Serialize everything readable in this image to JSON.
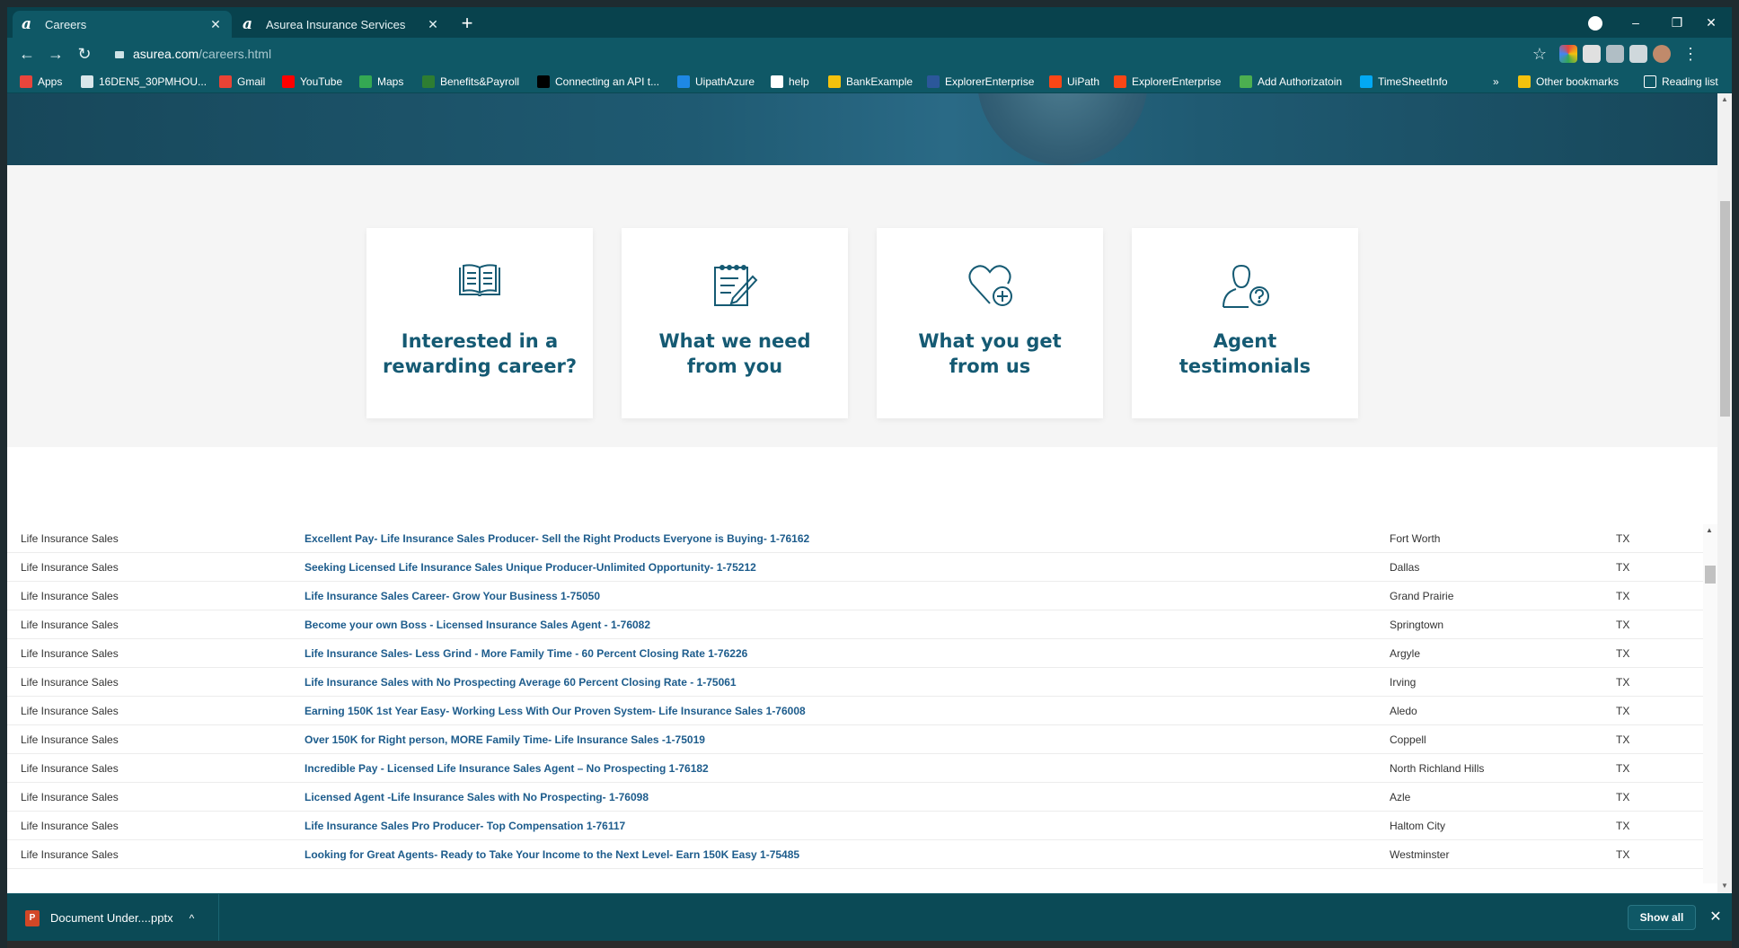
{
  "browser": {
    "tabs": [
      {
        "favicon": "a",
        "title": "Careers",
        "close": "✕",
        "active": true
      },
      {
        "favicon": "a",
        "title": "Asurea Insurance Services",
        "close": "✕",
        "active": false
      }
    ],
    "new_tab": "+",
    "window_controls": {
      "minimize": "–",
      "restore": "❐",
      "close": "✕"
    },
    "url_host": "asurea.com",
    "url_path": "/careers.html",
    "nav": {
      "back": "←",
      "forward": "→",
      "reload": "↻",
      "star": "☆",
      "menu": "⋮"
    }
  },
  "bookmarks": {
    "items": [
      {
        "label": "Apps",
        "color": "#e8453c"
      },
      {
        "label": "16DEN5_30PMHOU...",
        "color": "#d9e6ea"
      },
      {
        "label": "Gmail",
        "color": "#ea4335"
      },
      {
        "label": "YouTube",
        "color": "#ff0000"
      },
      {
        "label": "Maps",
        "color": "#34a853"
      },
      {
        "label": "Benefits&Payroll",
        "color": "#2e7d32"
      },
      {
        "label": "Connecting an API t...",
        "color": "#000000"
      },
      {
        "label": "UipathAzure",
        "color": "#1e88e5"
      },
      {
        "label": "help",
        "color": "#ffffff"
      },
      {
        "label": "BankExample",
        "color": "#f4c20d"
      },
      {
        "label": "ExplorerEnterprise",
        "color": "#2b579a"
      },
      {
        "label": "UiPath",
        "color": "#fa4616"
      },
      {
        "label": "ExplorerEnterprise",
        "color": "#fa4616"
      },
      {
        "label": "Add Authorizatoin",
        "color": "#4caf50"
      },
      {
        "label": "TimeSheetInfo",
        "color": "#03a9f4"
      }
    ],
    "more": "»",
    "other": "Other bookmarks",
    "reading_list": "Reading list"
  },
  "cards": [
    {
      "label": "Interested in a rewarding career?",
      "icon": "open-book-icon"
    },
    {
      "label": "What we need from you",
      "icon": "notepad-pen-icon"
    },
    {
      "label": "What you get from us",
      "icon": "heart-plus-icon"
    },
    {
      "label": "Agent testimonials",
      "icon": "person-question-icon"
    }
  ],
  "jobs": [
    {
      "category": "Life Insurance Sales",
      "title": "Excellent Pay- Life Insurance Sales Producer- Sell the Right Products Everyone is Buying- 1-76162",
      "city": "Fort Worth",
      "state": "TX"
    },
    {
      "category": "Life Insurance Sales",
      "title": "Seeking Licensed Life Insurance Sales Unique Producer-Unlimited Opportunity- 1-75212",
      "city": "Dallas",
      "state": "TX"
    },
    {
      "category": "Life Insurance Sales",
      "title": "Life Insurance Sales Career- Grow Your Business 1-75050",
      "city": "Grand Prairie",
      "state": "TX"
    },
    {
      "category": "Life Insurance Sales",
      "title": "Become your own Boss - Licensed Insurance Sales Agent - 1-76082",
      "city": "Springtown",
      "state": "TX"
    },
    {
      "category": "Life Insurance Sales",
      "title": "Life Insurance Sales- Less Grind - More Family Time - 60 Percent Closing Rate 1-76226",
      "city": "Argyle",
      "state": "TX"
    },
    {
      "category": "Life Insurance Sales",
      "title": "Life Insurance Sales with No Prospecting Average 60 Percent Closing Rate - 1-75061",
      "city": "Irving",
      "state": "TX"
    },
    {
      "category": "Life Insurance Sales",
      "title": "Earning 150K 1st Year Easy- Working Less With Our Proven System- Life Insurance Sales 1-76008",
      "city": "Aledo",
      "state": "TX"
    },
    {
      "category": "Life Insurance Sales",
      "title": "Over 150K for Right person, MORE Family Time- Life Insurance Sales -1-75019",
      "city": "Coppell",
      "state": "TX"
    },
    {
      "category": "Life Insurance Sales",
      "title": "Incredible Pay - Licensed Life Insurance Sales Agent – No Prospecting 1-76182",
      "city": "North Richland Hills",
      "state": "TX"
    },
    {
      "category": "Life Insurance Sales",
      "title": "Licensed Agent -Life Insurance Sales with No Prospecting- 1-76098",
      "city": "Azle",
      "state": "TX"
    },
    {
      "category": "Life Insurance Sales",
      "title": "Life Insurance Sales Pro Producer- Top Compensation 1-76117",
      "city": "Haltom City",
      "state": "TX"
    },
    {
      "category": "Life Insurance Sales",
      "title": "Looking for Great Agents- Ready to Take Your Income to the Next Level- Earn 150K Easy 1-75485",
      "city": "Westminster",
      "state": "TX"
    }
  ],
  "downloads": {
    "file_name": "Document Under....pptx",
    "file_badge": "P",
    "chevron": "^",
    "show_all": "Show all",
    "close": "✕"
  },
  "colors": {
    "browser_frame": "#0b4a56",
    "card_text": "#155a73",
    "link": "#1d5c8c"
  }
}
